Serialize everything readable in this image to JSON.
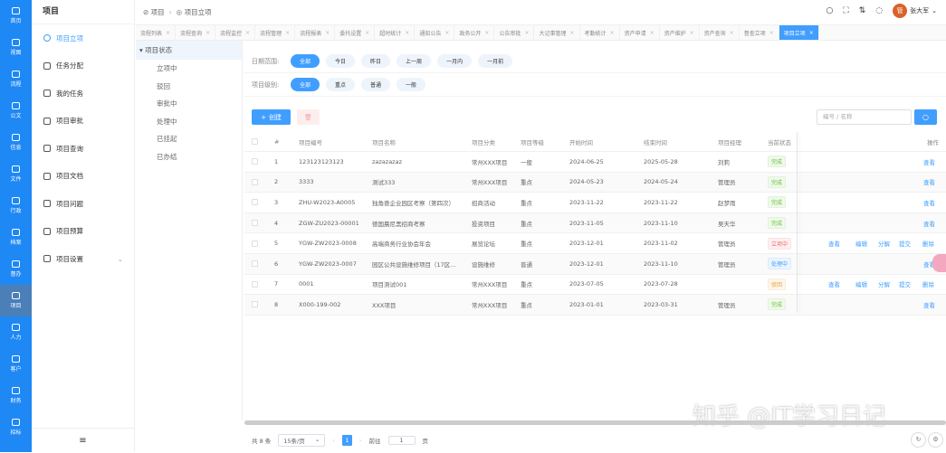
{
  "rail": [
    {
      "label": "首页"
    },
    {
      "label": "视图"
    },
    {
      "label": "流程"
    },
    {
      "label": "公文"
    },
    {
      "label": "信息"
    },
    {
      "label": "文件"
    },
    {
      "label": "行政"
    },
    {
      "label": "档案"
    },
    {
      "label": "督办"
    },
    {
      "label": "项目",
      "active": true
    },
    {
      "label": "人力"
    },
    {
      "label": "客户"
    },
    {
      "label": "财务"
    },
    {
      "label": "招标"
    }
  ],
  "nav": {
    "title": "项目",
    "items": [
      {
        "label": "项目立项",
        "active": true
      },
      {
        "label": "任务分配"
      },
      {
        "label": "我的任务"
      },
      {
        "label": "项目审批"
      },
      {
        "label": "项目查询"
      },
      {
        "label": "项目文档"
      },
      {
        "label": "项目问题"
      },
      {
        "label": "项目预算"
      },
      {
        "label": "项目设置",
        "expandable": true
      }
    ],
    "collapse_icon": "≡"
  },
  "breadcrumb": [
    "项目",
    "项目立项"
  ],
  "header": {
    "user": "张大军",
    "avatar": "管"
  },
  "tabs": [
    "流程列表",
    "流程查询",
    "流程监控",
    "流程管理",
    "流程报表",
    "委托设置",
    "超时统计",
    "通知公告",
    "政务公开",
    "公告审批",
    "大记事管理",
    "考勤统计",
    "资产申请",
    "资产维护",
    "资产查询",
    "督查立项",
    "项目立项"
  ],
  "tree": {
    "root": "项目状态",
    "children": [
      "立项中",
      "驳回",
      "审批中",
      "处理中",
      "已挂起",
      "已办结"
    ]
  },
  "filters": {
    "date_label": "日期范围:",
    "date_options": [
      "全部",
      "今日",
      "昨日",
      "上一周",
      "一月内",
      "一月前"
    ],
    "level_label": "项目级别:",
    "level_options": [
      "全部",
      "重点",
      "普通",
      "一般"
    ]
  },
  "toolbar": {
    "create": "创建",
    "search_placeholder": "编号 / 名称"
  },
  "table": {
    "headers": [
      "#",
      "项目编号",
      "项目名称",
      "项目分类",
      "项目等级",
      "开始时间",
      "结束时间",
      "项目经理",
      "当前状态",
      "操作"
    ],
    "rows": [
      {
        "no": "1",
        "code": "123123123123",
        "name": "zazazazaz",
        "category": "常州XXX项目",
        "level": "一般",
        "start": "2024-06-25",
        "end": "2025-05-28",
        "manager": "刘莉",
        "status": "完成",
        "status_type": "done",
        "actions": [
          "查看"
        ]
      },
      {
        "no": "2",
        "code": "3333",
        "name": "测试333",
        "category": "常州XXX项目",
        "level": "重点",
        "start": "2024-05-23",
        "end": "2024-05-24",
        "manager": "管理员",
        "status": "完成",
        "status_type": "done",
        "actions": [
          "查看"
        ]
      },
      {
        "no": "3",
        "code": "ZHU-W2023-A0005",
        "name": "独角兽企业园区考察（第四次）",
        "category": "招商活动",
        "level": "重点",
        "start": "2023-11-22",
        "end": "2023-11-22",
        "manager": "赵梦雨",
        "status": "完成",
        "status_type": "done",
        "actions": [
          "查看"
        ]
      },
      {
        "no": "4",
        "code": "ZGW-ZU2023-00001",
        "name": "德国晨尼黑招商考察",
        "category": "投资项目",
        "level": "重点",
        "start": "2023-11-05",
        "end": "2023-11-10",
        "manager": "吴天华",
        "status": "完成",
        "status_type": "done",
        "actions": [
          "查看"
        ]
      },
      {
        "no": "5",
        "code": "YGW-ZW2023-0008",
        "name": "高端商务行业协会年会",
        "category": "展览论坛",
        "level": "重点",
        "start": "2023-12-01",
        "end": "2023-11-02",
        "manager": "管理员",
        "status": "立项中",
        "status_type": "init",
        "actions": [
          "查看",
          "编辑",
          "分解",
          "提交",
          "删除"
        ]
      },
      {
        "no": "6",
        "code": "YGW-ZW2023-0007",
        "name": "园区公共设施维修项目（17区...",
        "category": "设施维修",
        "level": "普通",
        "start": "2023-12-01",
        "end": "2023-11-10",
        "manager": "管理员",
        "status": "处理中",
        "status_type": "proc",
        "actions": [
          "查看"
        ]
      },
      {
        "no": "7",
        "code": "0001",
        "name": "项目测试001",
        "category": "常州XXX项目",
        "level": "重点",
        "start": "2023-07-05",
        "end": "2023-07-28",
        "manager": "",
        "status": "驳回",
        "status_type": "rej",
        "actions": [
          "查看",
          "编辑",
          "分解",
          "提交",
          "删除"
        ]
      },
      {
        "no": "8",
        "code": "X000-199-002",
        "name": "XXX项目",
        "category": "常州XXX项目",
        "level": "重点",
        "start": "2023-01-01",
        "end": "2023-03-31",
        "manager": "管理员",
        "status": "完成",
        "status_type": "done",
        "actions": [
          "查看"
        ]
      }
    ]
  },
  "pagination": {
    "total": "共 8 条",
    "page_size": "15条/页",
    "current": "1",
    "goto_label": "前往",
    "goto_value": "1",
    "page_suffix": "页"
  },
  "watermark": "知乎 @IT学习日记"
}
